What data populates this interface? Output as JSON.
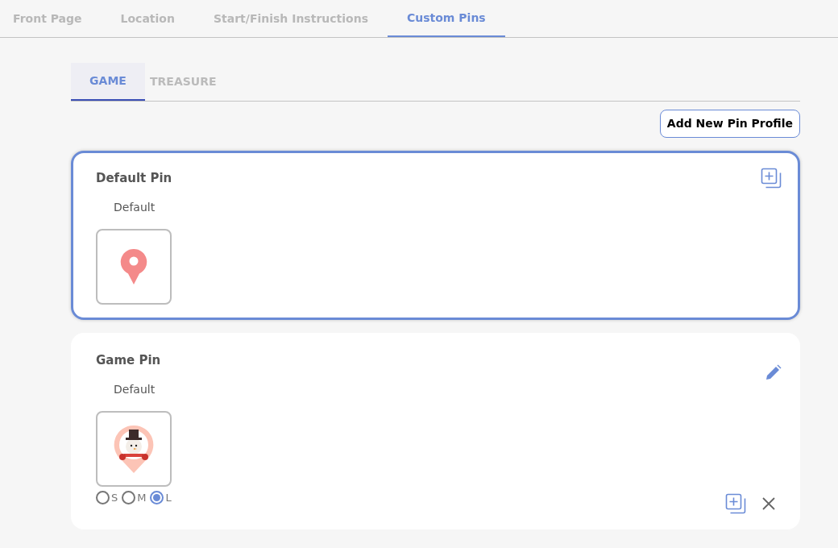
{
  "main_tabs": [
    {
      "label": "Front Page",
      "selected": false
    },
    {
      "label": "Location",
      "selected": false
    },
    {
      "label": "Start/Finish Instructions",
      "selected": false
    },
    {
      "label": "Custom Pins",
      "selected": true
    }
  ],
  "sub_tabs": [
    {
      "label": "GAME",
      "selected": true
    },
    {
      "label": "TREASURE",
      "selected": false
    }
  ],
  "add_button": "Add New Pin Profile",
  "pin_profiles": [
    {
      "title": "Default Pin",
      "subtitle": "Default",
      "selected": true,
      "kind": "plain",
      "editable": false
    },
    {
      "title": "Game Pin",
      "subtitle": "Default",
      "selected": false,
      "kind": "snowman",
      "editable": true,
      "sizes": [
        {
          "label": "S",
          "selected": false
        },
        {
          "label": "M",
          "selected": false
        },
        {
          "label": "L",
          "selected": true
        }
      ]
    }
  ]
}
